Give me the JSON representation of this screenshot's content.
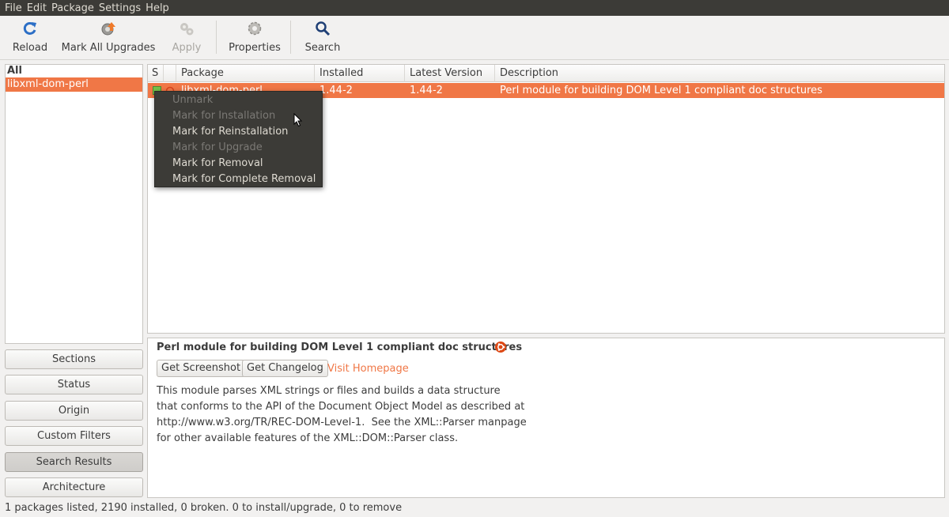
{
  "menubar": {
    "items": [
      "File",
      "Edit",
      "Package",
      "Settings",
      "Help"
    ]
  },
  "toolbar": {
    "reload": "Reload",
    "mark_all_upgrades": "Mark All Upgrades",
    "apply": "Apply",
    "properties": "Properties",
    "search": "Search"
  },
  "filter_list": {
    "header": "All",
    "items": [
      "libxml-dom-perl"
    ]
  },
  "side_buttons": [
    "Sections",
    "Status",
    "Origin",
    "Custom Filters",
    "Search Results",
    "Architecture"
  ],
  "table": {
    "columns": [
      "S",
      "Package",
      "Installed Version",
      "Latest Version",
      "Description"
    ],
    "rows": [
      {
        "package": "libxml-dom-perl",
        "installed": "1.44-2",
        "latest": "1.44-2",
        "description": "Perl module for building DOM Level 1 compliant doc structures"
      }
    ]
  },
  "context_menu": {
    "items": [
      {
        "label": "Unmark",
        "enabled": false
      },
      {
        "label": "Mark for Installation",
        "enabled": false
      },
      {
        "label": "Mark for Reinstallation",
        "enabled": true
      },
      {
        "label": "Mark for Upgrade",
        "enabled": false
      },
      {
        "label": "Mark for Removal",
        "enabled": true
      },
      {
        "label": "Mark for Complete Removal",
        "enabled": true
      }
    ]
  },
  "details": {
    "title": "Perl module for building DOM Level 1 compliant doc structures",
    "get_screenshot": "Get Screenshot",
    "get_changelog": "Get Changelog",
    "visit_homepage": "Visit Homepage",
    "description_lines": [
      "This module parses XML strings or files and builds a data structure",
      "that conforms to the API of the Document Object Model as described at",
      "http://www.w3.org/TR/REC-DOM-Level-1.  See the XML::Parser manpage",
      "for other available features of the XML::DOM::Parser class."
    ]
  },
  "statusbar": {
    "text": "1 packages listed, 2190 installed, 0 broken. 0 to install/upgrade, 0 to remove"
  },
  "colors": {
    "accent": "#f07746",
    "menubar_bg": "#3c3b37",
    "window_bg": "#f2f1f0"
  }
}
